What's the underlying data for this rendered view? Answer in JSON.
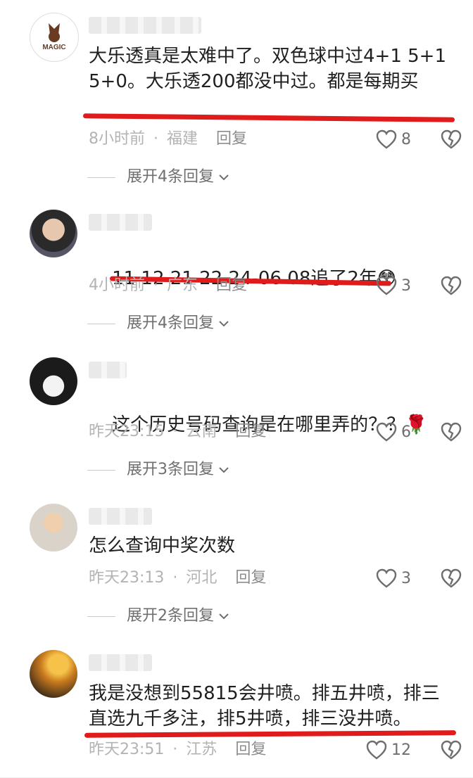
{
  "comments": [
    {
      "username": "",
      "text": "大乐透真是太难中了。双色球中过4+1 5+1  5+0。大乐透200都没中过。都是每期买",
      "time": "8小时前",
      "location": "福建",
      "reply": "回复",
      "likes": "8",
      "expand": "展开4条回复",
      "avatar_text": "MAGIC"
    },
    {
      "username": "",
      "text": "11 12 21 22 24-06 08追了2年",
      "emoji": "😳",
      "time": "4小时前",
      "location": "广东",
      "reply": "回复",
      "likes": "3",
      "expand": "展开4条回复"
    },
    {
      "username": "",
      "text": "这个历史号码查询是在哪里弄的？？",
      "emoji": "🌹",
      "time": "昨天23:15",
      "location": "云南",
      "reply": "回复",
      "likes": "6",
      "expand": "展开3条回复"
    },
    {
      "username": "",
      "text": "怎么查询中奖次数",
      "time": "昨天23:13",
      "location": "河北",
      "reply": "回复",
      "likes": "3",
      "expand": "展开2条回复"
    },
    {
      "username": "",
      "text": "我是没想到55815会井喷。排五井喷，排三直选九千多注，排5井喷，排三没井喷。",
      "time": "昨天23:51",
      "location": "江苏",
      "reply": "回复",
      "likes": "12"
    }
  ],
  "colors": {
    "annotation_red": "#e01b1b",
    "meta_gray": "#b3b3b3",
    "text": "#1f1f1f"
  },
  "icons": [
    "heart-outline-icon",
    "broken-heart-icon",
    "chevron-down-icon"
  ]
}
